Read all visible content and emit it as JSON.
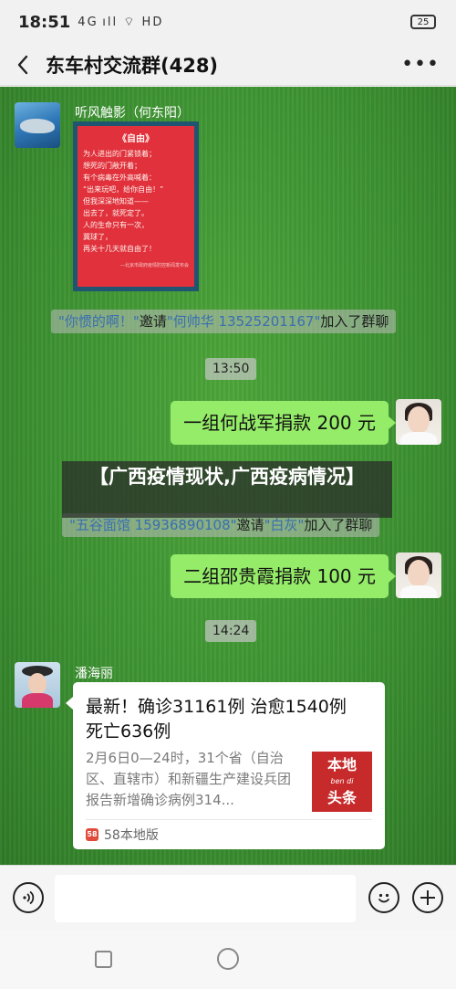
{
  "status_bar": {
    "time": "18:51",
    "indicators": "4G ıll ⌔ HD",
    "battery": "25"
  },
  "header": {
    "title": "东车村交流群(428)",
    "more": "•••"
  },
  "messages": {
    "msg1": {
      "sender": "听风触影（何东阳）",
      "poster": {
        "title": "《自由》",
        "lines": [
          "为人进出的门紧锁着；",
          "想死的门敞开着；",
          "有个病毒在外高喊着：",
          "“出来玩吧，给你自由！”",
          "但我深深地知道——",
          "出去了，就死定了。",
          "人的生命只有一次，",
          "冀球了，",
          "再关十几天就自由了！"
        ],
        "footer": "—北京市政府疫情防控新闻发布会"
      }
    },
    "notice1": {
      "inviter": "\"你惯的啊！\"",
      "action": "邀请",
      "invitee": "\"何帅华 13525201167\"",
      "result": "加入了群聊"
    },
    "time1": "13:50",
    "msg2": {
      "text": "一组何战军捐款 200 元"
    },
    "notice2": {
      "inviter": "\"五谷面馆 15936890108\"",
      "action": "邀请",
      "invitee": "\"白灰\"",
      "result": "加入了群聊"
    },
    "msg3": {
      "text": "二组邵贵霞捐款 100 元"
    },
    "time2": "14:24",
    "msg4": {
      "sender": "潘海丽",
      "card_title": "最新！确诊31161例 治愈1540例 死亡636例",
      "card_desc": "2月6日0—24时，31个省（自治区、直辖市）和新疆生产建设兵团报告新增确诊病例314...",
      "thumb_main": "本地",
      "thumb_sub": "ben di",
      "thumb_main2": "头条",
      "source": "58本地版"
    }
  },
  "overlay": {
    "title": "【广西疫情现状,广西疫病情况】"
  },
  "input": {
    "placeholder": ""
  }
}
